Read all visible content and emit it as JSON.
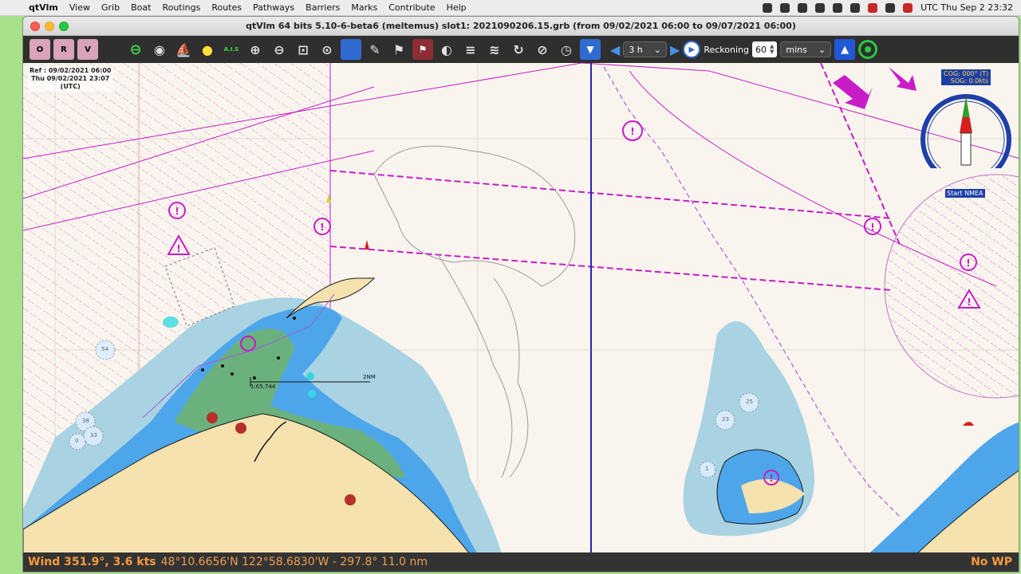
{
  "menubar": {
    "app": "qtVlm",
    "items": [
      "View",
      "Grib",
      "Boat",
      "Routings",
      "Routes",
      "Pathways",
      "Barriers",
      "Marks",
      "Contribute",
      "Help"
    ],
    "clock": "UTC Thu Sep 2  23:32"
  },
  "window": {
    "title": "qtVlm 64 bits 5.10-6-beta6 (meltemus) slot1: 2021090206.15.grb (from 09/02/2021 06:00 to 09/07/2021 06:00)"
  },
  "toolbar": {
    "chart_buttons": [
      "O",
      "R",
      "V"
    ],
    "ais_label": "A.I.S",
    "time_step": "3 h",
    "reckoning_label": "Reckoning",
    "reckoning_value": "60",
    "reckoning_unit": "mins"
  },
  "map": {
    "ref_line1": "Ref : 09/02/2021 06:00",
    "ref_line2": "Thu 09/02/2021 23:07",
    "ref_line3": "(UTC)",
    "scale_ratio": "1:65,744",
    "scale_distance": "2NM",
    "soundings": [
      "54",
      "38",
      "33",
      "0",
      "23",
      "25",
      "1"
    ],
    "cog": "COG: 000° (T)",
    "sog": "SOG: 0.0kts",
    "start_nmea": "Start NMEA"
  },
  "statusbar": {
    "wind": "Wind 351.9°, 3.6 kts",
    "position": "48°10.6656'N 122°58.6830'W - 297.8° 11.0 nm",
    "waypoint": "No WP"
  },
  "colors": {
    "land": "#f5e2ae",
    "shallow_blue": "#4ea6ea",
    "mid_blue": "#a9d3e2",
    "intertidal": "#6ab17e",
    "sea": "#f9f5ee",
    "magenta": "#c81cc8",
    "status_text": "#f59a3c"
  }
}
